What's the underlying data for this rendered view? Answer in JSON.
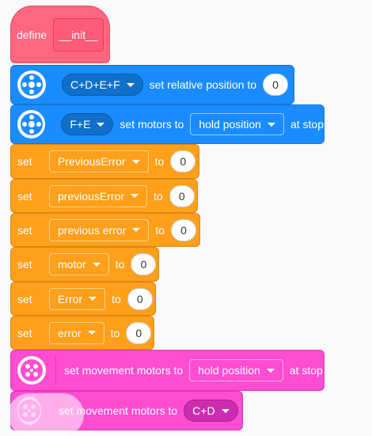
{
  "define_block": {
    "label": "define",
    "name": "__init__"
  },
  "blocks": {
    "relpos": {
      "motors": "C+D+E+F",
      "text": "set relative position to",
      "value": "0"
    },
    "stopmode": {
      "motors": "F+E",
      "text": "set motors to",
      "mode": "hold position",
      "suffix": "at stop"
    },
    "vars": [
      {
        "set": "set",
        "var": "PreviousError",
        "to": "to",
        "value": "0"
      },
      {
        "set": "set",
        "var": "previousError",
        "to": "to",
        "value": "0"
      },
      {
        "set": "set",
        "var": "previous error",
        "to": "to",
        "value": "0"
      },
      {
        "set": "set",
        "var": "motor",
        "to": "to",
        "value": "0"
      },
      {
        "set": "set",
        "var": "Error",
        "to": "to",
        "value": "0"
      },
      {
        "set": "set",
        "var": "error",
        "to": "to",
        "value": "0"
      }
    ],
    "move_stop": {
      "text": "set movement motors to",
      "mode": "hold position",
      "suffix": "at stop"
    },
    "move_motors": {
      "text": "set movement motors to",
      "motors": "C+D"
    }
  },
  "colors": {
    "events": "#ff6680",
    "motors": "#1a8cff",
    "variables": "#ff9f1a",
    "movement": "#ff4dd2"
  },
  "icons": {
    "motor": "motor-icon",
    "movement": "movement-icon",
    "dropdown": "chevron-down-icon"
  }
}
